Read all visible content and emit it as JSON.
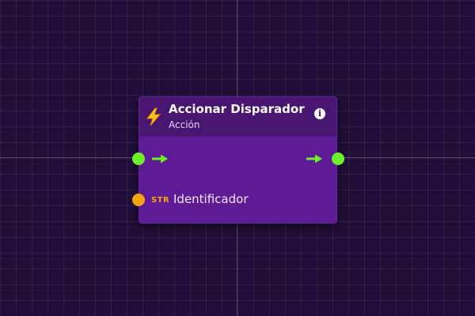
{
  "node": {
    "title": "Accionar Disparador",
    "subtitle": "Acción",
    "info_icon": "info-icon",
    "header_icon": "lightning-icon",
    "colors": {
      "header": "#481570",
      "body": "#5f1b95",
      "exec_pin": "#6bf02a",
      "string_pin": "#f4a312",
      "icon": "#f5c518"
    },
    "info_glyph": "i",
    "inputs": [
      {
        "type": "exec"
      },
      {
        "type_label": "STR",
        "label": "Identificador"
      }
    ],
    "outputs": [
      {
        "type": "exec"
      }
    ]
  }
}
